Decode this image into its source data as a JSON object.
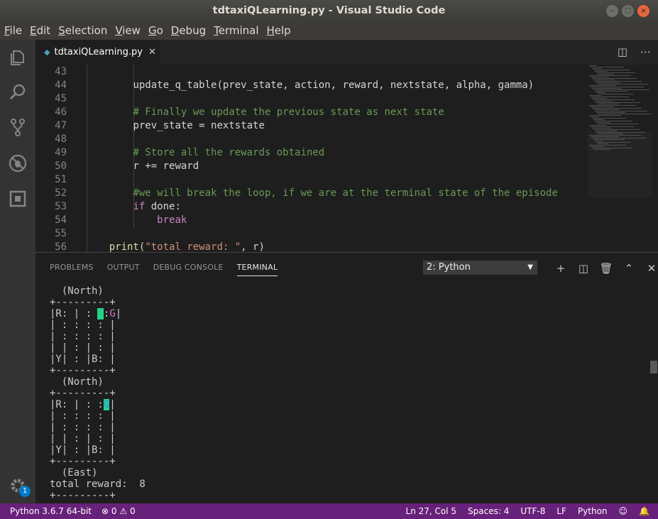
{
  "window": {
    "title": "tdtaxiQLearning.py - Visual Studio Code"
  },
  "menu": [
    {
      "u": "F",
      "rest": "ile"
    },
    {
      "u": "E",
      "rest": "dit"
    },
    {
      "u": "S",
      "rest": "election"
    },
    {
      "u": "V",
      "rest": "iew"
    },
    {
      "u": "G",
      "rest": "o"
    },
    {
      "u": "D",
      "rest": "ebug"
    },
    {
      "u": "T",
      "rest": "erminal"
    },
    {
      "u": "H",
      "rest": "elp"
    }
  ],
  "activity": {
    "icons": [
      "explorer-icon",
      "search-icon",
      "source-control-icon",
      "debug-icon",
      "extensions-icon"
    ],
    "settings_badge": "1"
  },
  "editor": {
    "tab": {
      "filename": "tdtaxiQLearning.py",
      "icon": "python-file-icon"
    },
    "lines": [
      {
        "n": "43",
        "indent": "",
        "tokens": []
      },
      {
        "n": "44",
        "indent": "        ",
        "tokens": [
          {
            "t": "update_q_table(prev_state, action, reward, nextstate, alpha, gamma)",
            "c": ""
          }
        ]
      },
      {
        "n": "45",
        "indent": "",
        "tokens": []
      },
      {
        "n": "46",
        "indent": "        ",
        "tokens": [
          {
            "t": "# Finally we update the previous state as next state",
            "c": "c-cm"
          }
        ]
      },
      {
        "n": "47",
        "indent": "        ",
        "tokens": [
          {
            "t": "prev_state = nextstate",
            "c": ""
          }
        ]
      },
      {
        "n": "48",
        "indent": "",
        "tokens": []
      },
      {
        "n": "49",
        "indent": "        ",
        "tokens": [
          {
            "t": "# Store all the rewards obtained",
            "c": "c-cm"
          }
        ]
      },
      {
        "n": "50",
        "indent": "        ",
        "tokens": [
          {
            "t": "r += reward",
            "c": ""
          }
        ]
      },
      {
        "n": "51",
        "indent": "",
        "tokens": []
      },
      {
        "n": "52",
        "indent": "        ",
        "tokens": [
          {
            "t": "#we will break the loop, if we are at the terminal state of the episode",
            "c": "c-cm"
          }
        ]
      },
      {
        "n": "53",
        "indent": "        ",
        "tokens": [
          {
            "t": "if",
            "c": "c-kw"
          },
          {
            "t": " done:",
            "c": ""
          }
        ]
      },
      {
        "n": "54",
        "indent": "            ",
        "tokens": [
          {
            "t": "break",
            "c": "c-kw"
          }
        ]
      },
      {
        "n": "55",
        "indent": "",
        "tokens": []
      },
      {
        "n": "56",
        "indent": "    ",
        "tokens": [
          {
            "t": "print",
            "c": "c-fn"
          },
          {
            "t": "(",
            "c": ""
          },
          {
            "t": "\"total reward: \"",
            "c": "c-str"
          },
          {
            "t": ", r)",
            "c": ""
          }
        ]
      }
    ]
  },
  "panel": {
    "tabs": [
      "PROBLEMS",
      "OUTPUT",
      "DEBUG CONSOLE",
      "TERMINAL"
    ],
    "active_tab": "TERMINAL",
    "terminal_select": "2: Python",
    "actions": [
      "add-terminal-icon",
      "split-terminal-icon",
      "kill-terminal-icon",
      "maximize-panel-icon",
      "close-panel-icon"
    ]
  },
  "terminal": {
    "lines": [
      [
        {
          "t": "  (North)"
        }
      ],
      [
        {
          "t": "+---------+"
        }
      ],
      [
        {
          "t": "|R: | : "
        },
        {
          "t": ":",
          "s": "cursor-bg"
        },
        {
          "t": ":"
        },
        {
          "t": "G",
          "s": "g-mag"
        },
        {
          "t": "|"
        }
      ],
      [
        {
          "t": "| : : : : |"
        }
      ],
      [
        {
          "t": "| : : : : |"
        }
      ],
      [
        {
          "t": "| | : | : |"
        }
      ],
      [
        {
          "t": "|Y| : |B: |"
        }
      ],
      [
        {
          "t": "+---------+"
        }
      ],
      [
        {
          "t": "  (North)"
        }
      ],
      [
        {
          "t": "+---------+"
        }
      ],
      [
        {
          "t": "|R: | : :"
        },
        {
          "t": "G",
          "s": "cursor-g"
        },
        {
          "t": "|"
        }
      ],
      [
        {
          "t": "| : : : : |"
        }
      ],
      [
        {
          "t": "| : : : : |"
        }
      ],
      [
        {
          "t": "| | : | : |"
        }
      ],
      [
        {
          "t": "|Y| : |B: |"
        }
      ],
      [
        {
          "t": "+---------+"
        }
      ],
      [
        {
          "t": "  (East)"
        }
      ],
      [
        {
          "t": "total reward:  8"
        }
      ],
      [
        {
          "t": "+---------+"
        }
      ]
    ]
  },
  "status": {
    "interpreter": "Python 3.6.7 64-bit",
    "errors": "0",
    "warnings": "0",
    "position": "Ln 27, Col 5",
    "spaces": "Spaces: 4",
    "encoding": "UTF-8",
    "eol": "LF",
    "language": "Python"
  },
  "colors": {
    "status_bar": "#68217a",
    "comment": "#6a9955",
    "keyword": "#c586c0",
    "string": "#ce9178",
    "terminal_cursor": "#23d18b"
  }
}
